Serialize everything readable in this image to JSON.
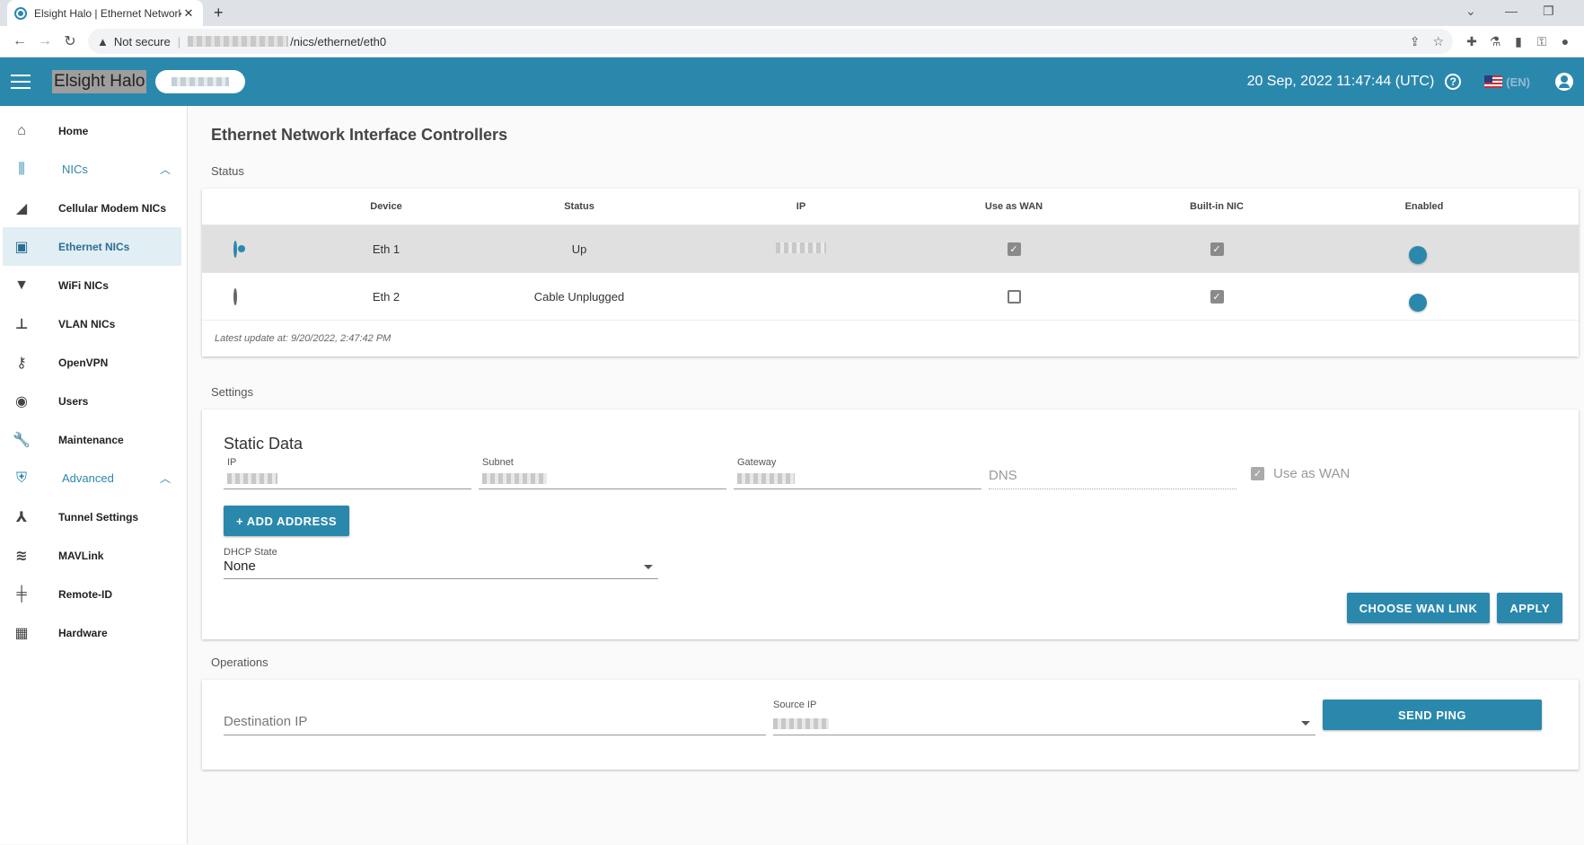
{
  "browser": {
    "tab_title": "Elsight Halo | Ethernet Network I",
    "tab_close": "✕",
    "new_tab": "+",
    "security_text": "Not secure",
    "url_path": "/nics/ethernet/eth0"
  },
  "header": {
    "app_title": "Elsight Halo",
    "datetime": "20 Sep, 2022 11:47:44 (UTC)",
    "help": "?",
    "language": "(EN)"
  },
  "sidebar": {
    "items": [
      {
        "label": "Home",
        "icon": "home-icon"
      },
      {
        "label": "NICs",
        "icon": "nics-icon",
        "group": true
      },
      {
        "label": "Cellular Modem NICs",
        "icon": "signal-icon"
      },
      {
        "label": "Ethernet NICs",
        "icon": "ethernet-icon",
        "active": true
      },
      {
        "label": "WiFi NICs",
        "icon": "wifi-icon"
      },
      {
        "label": "VLAN NICs",
        "icon": "network-tree-icon"
      },
      {
        "label": "OpenVPN",
        "icon": "key-icon"
      },
      {
        "label": "Users",
        "icon": "user-icon"
      },
      {
        "label": "Maintenance",
        "icon": "wrench-icon"
      },
      {
        "label": "Advanced",
        "icon": "shield-icon",
        "group": true
      },
      {
        "label": "Tunnel Settings",
        "icon": "merge-icon"
      },
      {
        "label": "MAVLink",
        "icon": "cast-icon"
      },
      {
        "label": "Remote-ID",
        "icon": "antenna-icon"
      },
      {
        "label": "Hardware",
        "icon": "hardware-icon"
      }
    ]
  },
  "main": {
    "page_title": "Ethernet Network Interface Controllers",
    "status_label": "Status",
    "table": {
      "headers": [
        "",
        "Device",
        "Status",
        "IP",
        "Use as WAN",
        "Built-in NIC",
        "Enabled"
      ],
      "rows": [
        {
          "device": "Eth 1",
          "status": "Up",
          "selected": true,
          "use_as_wan": true,
          "builtin": true,
          "enabled": true
        },
        {
          "device": "Eth 2",
          "status": "Cable Unplugged",
          "selected": false,
          "use_as_wan": false,
          "builtin": true,
          "enabled": true
        }
      ],
      "latest_update": "Latest update at: 9/20/2022, 2:47:42 PM"
    },
    "settings_label": "Settings",
    "static_data": {
      "title": "Static Data",
      "ip_label": "IP",
      "subnet_label": "Subnet",
      "gateway_label": "Gateway",
      "dns_placeholder": "DNS",
      "use_as_wan_label": "Use as WAN",
      "add_address_label": "+ ADD ADDRESS",
      "dhcp_label": "DHCP State",
      "dhcp_value": "None",
      "choose_wan_label": "CHOOSE WAN LINK",
      "apply_label": "APPLY"
    },
    "operations_label": "Operations",
    "operations": {
      "destination_placeholder": "Destination IP",
      "source_label": "Source IP",
      "send_ping_label": "SEND PING"
    }
  }
}
